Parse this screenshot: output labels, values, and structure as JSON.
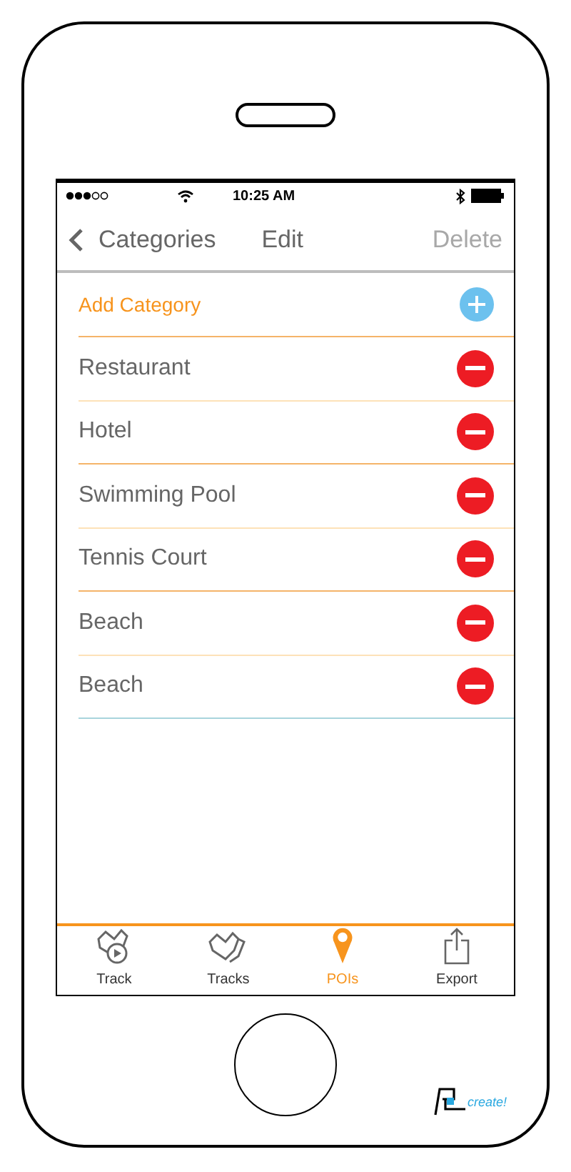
{
  "status_bar": {
    "time": "10:25 AM"
  },
  "nav_bar": {
    "back_label": "Categories",
    "edit_label": "Edit",
    "delete_label": "Delete",
    "delete_disabled": true
  },
  "add_row": {
    "label": "Add Category"
  },
  "categories": [
    {
      "label": "Restaurant"
    },
    {
      "label": "Hotel"
    },
    {
      "label": "Swimming Pool"
    },
    {
      "label": "Tennis Court"
    },
    {
      "label": "Beach"
    },
    {
      "label": "Beach"
    }
  ],
  "tab_bar": [
    {
      "label": "Track",
      "kind": "track",
      "selected": false
    },
    {
      "label": "Tracks",
      "kind": "tracks",
      "selected": false
    },
    {
      "label": "POIs",
      "kind": "poi",
      "selected": true
    },
    {
      "label": "Export",
      "kind": "export",
      "selected": false
    }
  ],
  "logo": {
    "text": "create!"
  }
}
